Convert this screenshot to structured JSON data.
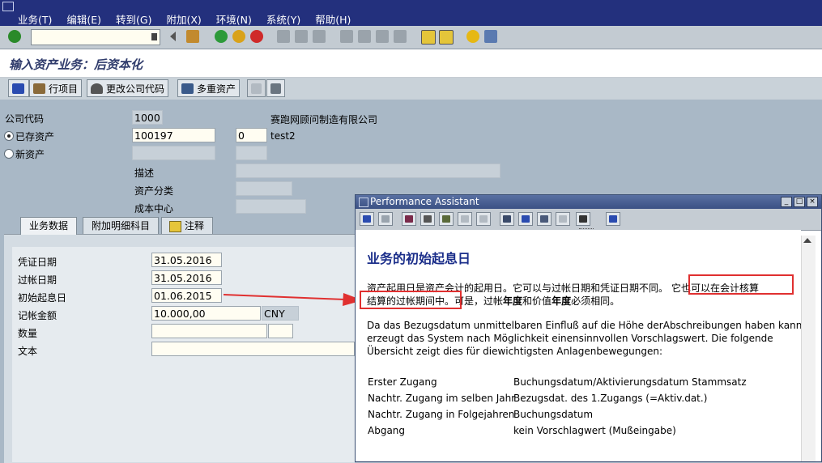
{
  "menu": [
    "业务(T)",
    "编辑(E)",
    "转到(G)",
    "附加(X)",
    "环境(N)",
    "系统(Y)",
    "帮助(H)"
  ],
  "title": "输入资产业务：后资本化",
  "app_toolbar": {
    "line_items": "行项目",
    "change_company": "更改公司代码",
    "multi_asset": "多重资产"
  },
  "form": {
    "company_code_label": "公司代码",
    "company_code": "1000",
    "company_name": "赛跑网顾问制造有限公司",
    "existing_asset_label": "已存资产",
    "asset_number": "100197",
    "sub_number": "0",
    "asset_text": "test2",
    "new_asset_label": "新资产",
    "description_label": "描述",
    "asset_class_label": "资产分类",
    "cost_center_label": "成本中心"
  },
  "tabs": [
    "业务数据",
    "附加明细科目",
    "注释"
  ],
  "transaction": {
    "doc_date_label": "凭证日期",
    "doc_date": "31.05.2016",
    "posting_date_label": "过帐日期",
    "posting_date": "31.05.2016",
    "value_date_label": "初始起息日",
    "value_date": "01.06.2015",
    "amount_label": "记帐金额",
    "amount": "10.000,00",
    "currency": "CNY",
    "quantity_label": "数量",
    "text_label": "文本"
  },
  "assistant": {
    "window_title": "Performance Assistant",
    "heading": "业务的初始起息日",
    "p1_a": "资产起用日是资产会计的起用日。它可以与过帐日期和凭证日期不同。",
    "p1_b": "它也可以在会计核算",
    "p1_c": "结算的过帐期间中。",
    "p1_d": "可是，过帐",
    "p1_e": "年度",
    "p1_f": "和价值",
    "p1_g": "年度",
    "p1_h": "必须相同。",
    "p2_1": "Da das Bezugsdatum unmittelbaren Einfluß auf die Höhe derAbschreibungen haben kann,",
    "p2_2": "erzeugt das System nach Möglichkeit einensinnvollen Vorschlagswert. Die folgende",
    "p2_3": "Übersicht zeigt dies für diewichtigsten Anlagenbewegungen:",
    "table": [
      {
        "a": "Erster Zugang",
        "b": "Buchungsdatum/Aktivierungsdatum Stammsatz"
      },
      {
        "a": "Nachtr. Zugang im selben Jahr",
        "b": "Bezugsdat. des 1.Zugangs (=Aktiv.dat.)"
      },
      {
        "a": "Nachtr. Zugang in Folgejahren",
        "b": "Buchungsdatum"
      },
      {
        "a": "Abgang",
        "b": "kein Vorschlagwert (Mußeingabe)"
      }
    ]
  }
}
